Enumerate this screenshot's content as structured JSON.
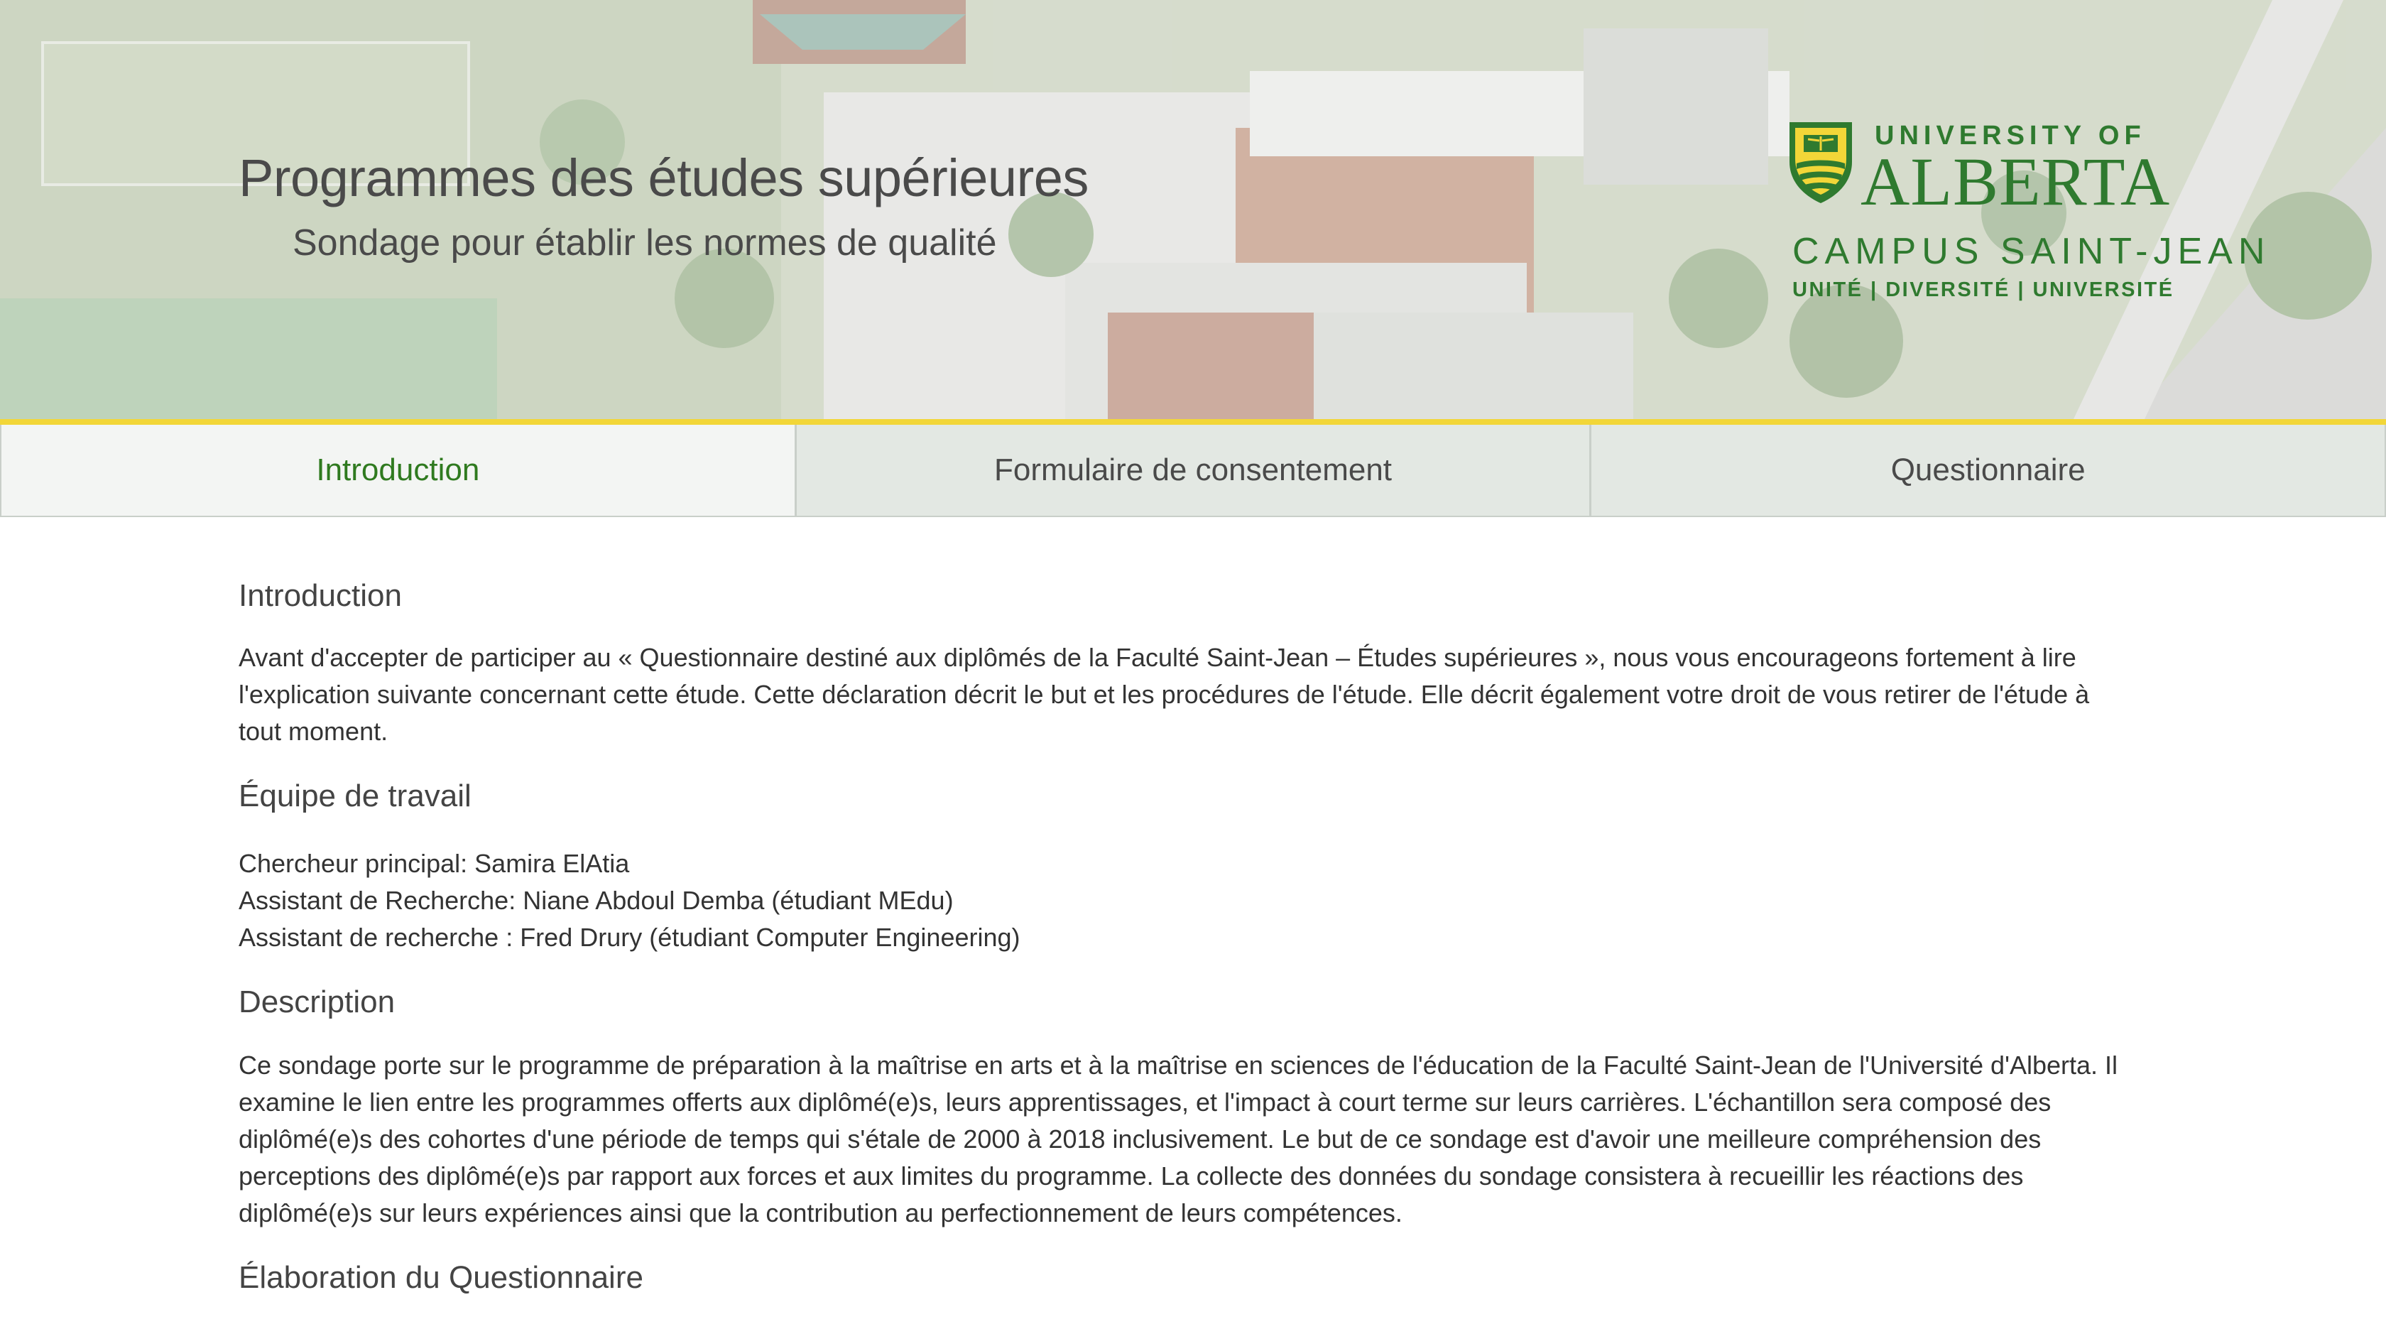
{
  "header": {
    "title": "Programmes des études supérieures",
    "subtitle": "Sondage pour établir les normes de qualité",
    "logo": {
      "line1": "UNIVERSITY OF",
      "line2": "ALBERTA",
      "line3": "CAMPUS SAINT-JEAN",
      "line4": "UNITÉ | DIVERSITÉ | UNIVERSITÉ",
      "brand_color": "#2f7a2f"
    }
  },
  "tabs": [
    {
      "label": "Introduction",
      "active": true
    },
    {
      "label": "Formulaire de consentement",
      "active": false
    },
    {
      "label": "Questionnaire",
      "active": false
    }
  ],
  "accent_colors": {
    "active_tab_text": "#2f7a1f",
    "divider_yellow": "#f2d638"
  },
  "sections": {
    "introduction": {
      "title": "Introduction",
      "text": "Avant d'accepter de participer au « Questionnaire destiné aux diplômés de la Faculté Saint-Jean – Études supérieures », nous vous encourageons fortement à lire l'explication suivante concernant cette étude. Cette déclaration décrit le but et les procédures de l'étude. Elle décrit également votre droit de vous retirer de l'étude à tout moment."
    },
    "team": {
      "title": "Équipe de travail",
      "members": [
        "Chercheur principal: Samira ElAtia",
        "Assistant de Recherche: Niane Abdoul Demba (étudiant MEdu)",
        "Assistant de recherche : Fred Drury (étudiant Computer Engineering)"
      ]
    },
    "description": {
      "title": "Description",
      "text": "Ce sondage porte sur le programme de préparation à la maîtrise en arts et à la maîtrise en sciences de l'éducation de la Faculté Saint-Jean de l'Université d'Alberta. Il examine le lien entre les programmes offerts aux diplômé(e)s, leurs apprentissages, et l'impact à court terme sur leurs carrières. L'échantillon sera composé des diplômé(e)s des cohortes d'une période de temps qui s'étale de 2000 à 2018 inclusivement. Le but de ce sondage est d'avoir une meilleure compréhension des perceptions des diplômé(e)s par rapport aux forces et aux limites du programme. La collecte des données du sondage consistera à recueillir les réactions des diplômé(e)s sur leurs expériences ainsi que la contribution au perfectionnement de leurs compétences."
    },
    "elaboration": {
      "title": "Élaboration du Questionnaire"
    }
  }
}
